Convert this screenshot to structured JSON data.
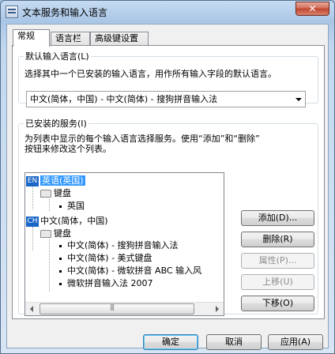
{
  "window": {
    "title": "文本服务和输入语言",
    "close_label": "✕"
  },
  "tabs": [
    {
      "label": "常规",
      "active": true
    },
    {
      "label": "语言栏",
      "active": false
    },
    {
      "label": "高级键设置",
      "active": false
    }
  ],
  "default_lang": {
    "legend": "默认输入语言(L)",
    "description": "选择其中一个已安装的输入语言，用作所有输入字段的默认语言。",
    "selected": "中文(简体，中国) - 中文(简体) - 搜狗拼音输入法"
  },
  "installed": {
    "legend": "已安装的服务(I)",
    "description_line1": "为列表中显示的每个输入语言选择服务。使用“添加”和“删除”",
    "description_line2": "按钮来修改这个列表。",
    "tree": {
      "lang1": {
        "icon": "EN",
        "label": "英语(英国)"
      },
      "lang1_keyboard": "键盘",
      "lang1_item": "英国",
      "lang2": {
        "icon": "CH",
        "label": "中文(简体，中国)"
      },
      "lang2_keyboard": "键盘",
      "lang2_items": [
        "中文(简体) - 搜狗拼音输入法",
        "中文(简体) - 美式键盘",
        "中文(简体) - 微软拼音 ABC 输入风",
        "微软拼音输入法 2007"
      ]
    },
    "buttons": {
      "add": "添加(D)...",
      "remove": "删除(R)",
      "properties": "属性(P)...",
      "move_up": "上移(U)",
      "move_down": "下移(O)"
    }
  },
  "footer": {
    "ok": "确定",
    "cancel": "取消",
    "apply": "应用(A)"
  }
}
